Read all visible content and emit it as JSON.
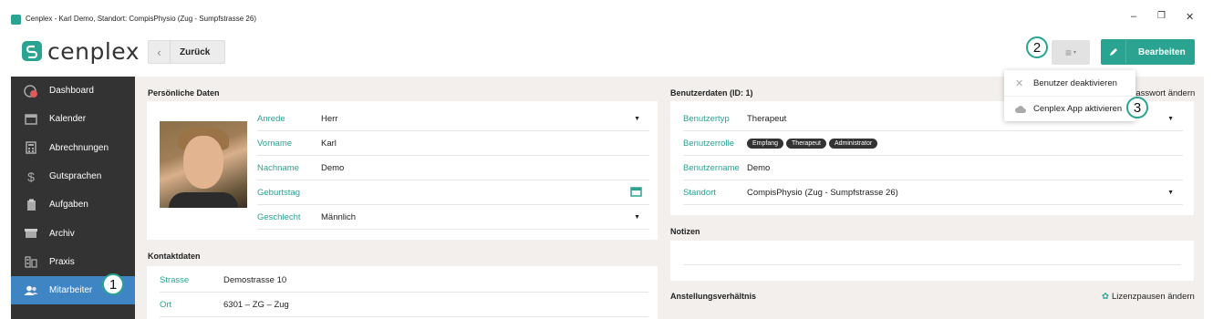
{
  "window": {
    "title": "Cenplex - Karl Demo, Standort: CompisPhysio (Zug - Sumpfstrasse 26)",
    "controls": [
      "–",
      "❐",
      "✕"
    ]
  },
  "header": {
    "logo": "cenplex",
    "back_label": "Zurück",
    "menu_icon": "≡",
    "edit_label": "Bearbeiten"
  },
  "callouts": [
    "1",
    "2",
    "3"
  ],
  "sidebar": {
    "items": [
      {
        "label": "Dashboard",
        "icon": "dashboard-icon"
      },
      {
        "label": "Kalender",
        "icon": "calendar-icon"
      },
      {
        "label": "Abrechnungen",
        "icon": "calculator-icon"
      },
      {
        "label": "Gutsprachen",
        "icon": "dollar-icon"
      },
      {
        "label": "Aufgaben",
        "icon": "clipboard-icon"
      },
      {
        "label": "Archiv",
        "icon": "archive-icon"
      },
      {
        "label": "Praxis",
        "icon": "building-icon"
      },
      {
        "label": "Mitarbeiter",
        "icon": "users-icon",
        "active": true
      }
    ]
  },
  "personal": {
    "title": "Persönliche Daten",
    "fields": [
      {
        "label": "Anrede",
        "value": "Herr",
        "dropdown": true
      },
      {
        "label": "Vorname",
        "value": "Karl"
      },
      {
        "label": "Nachname",
        "value": "Demo"
      },
      {
        "label": "Geburtstag",
        "value": ""
      },
      {
        "label": "Geschlecht",
        "value": "Männlich",
        "dropdown": true
      }
    ]
  },
  "contact": {
    "title": "Kontaktdaten",
    "fields": [
      {
        "label": "Strasse",
        "value": "Demostrasse 10"
      },
      {
        "label": "Ort",
        "value": "6301 – ZG – Zug"
      }
    ]
  },
  "user": {
    "title": "Benutzerdaten (ID: 1)",
    "password_link": "Passwort ändern",
    "fields": [
      {
        "label": "Benutzertyp",
        "value": "Therapeut",
        "dropdown": true
      },
      {
        "label": "Benutzerrolle",
        "badges": [
          "Empfang",
          "Therapeut",
          "Administrator"
        ]
      },
      {
        "label": "Benutzername",
        "value": "Demo"
      },
      {
        "label": "Standort",
        "value": "CompisPhysio (Zug - Sumpfstrasse 26)",
        "dropdown": true
      }
    ]
  },
  "notes": {
    "title": "Notizen"
  },
  "employment": {
    "title": "Anstellungsverhältnis",
    "link": "Lizenzpausen ändern"
  },
  "menu_dropdown": {
    "items": [
      {
        "label": "Benutzer deaktivieren",
        "icon": "close-icon"
      },
      {
        "label": "Cenplex App aktivieren",
        "icon": "cloud-icon"
      }
    ]
  },
  "colors": {
    "accent": "#2aa390",
    "sidebar": "#333333",
    "active": "#3f85c4"
  }
}
